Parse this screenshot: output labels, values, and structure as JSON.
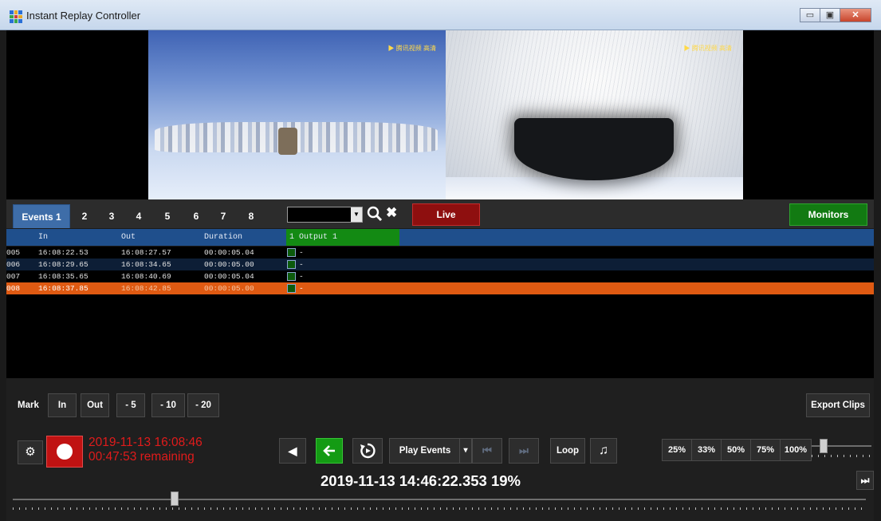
{
  "window": {
    "title": "Instant Replay Controller",
    "minimize": "▭",
    "restore": "▣",
    "close": "✕"
  },
  "video": {
    "watermark_left": "▶ 腾讯视频 高清",
    "watermark_right": "▶ 腾讯视频 高清"
  },
  "tabs": [
    {
      "label": "Events 1",
      "active": true
    },
    {
      "label": "2"
    },
    {
      "label": "3"
    },
    {
      "label": "4"
    },
    {
      "label": "5"
    },
    {
      "label": "6"
    },
    {
      "label": "7"
    },
    {
      "label": "8"
    }
  ],
  "toolbar": {
    "combo_value": "",
    "live_label": "Live",
    "monitors_label": "Monitors",
    "live_color": "#8e0f0f",
    "monitors_color": "#127a12"
  },
  "table": {
    "columns": {
      "in": "In",
      "out": "Out",
      "duration": "Duration",
      "output": "1 Output 1"
    },
    "rows": [
      {
        "id": "005",
        "in": "16:08:22.53",
        "out": "16:08:27.57",
        "duration": "00:00:05.04",
        "output": "-",
        "selected": false
      },
      {
        "id": "006",
        "in": "16:08:29.65",
        "out": "16:08:34.65",
        "duration": "00:00:05.00",
        "output": "-",
        "selected": false
      },
      {
        "id": "007",
        "in": "16:08:35.65",
        "out": "16:08:40.69",
        "duration": "00:00:05.04",
        "output": "-",
        "selected": false
      },
      {
        "id": "008",
        "in": "16:08:37.85",
        "out": "16:08:42.85",
        "duration": "00:00:05.00",
        "output": "-",
        "selected": true
      }
    ],
    "selected_color": "#df5a12"
  },
  "mark": {
    "label": "Mark",
    "in": "In",
    "out": "Out",
    "minus5": "- 5",
    "minus10": "- 10",
    "minus20": "- 20",
    "export": "Export Clips"
  },
  "recording": {
    "line1": "2019-11-13 16:08:46",
    "line2": "00:47:53 remaining",
    "text_color": "#e01b1b"
  },
  "transport": {
    "prev": "◀",
    "back": "🡐",
    "replay_icon": "replay-icon",
    "play_events": "Play Events",
    "dropdown": "▾",
    "skip_back": "⏮",
    "skip_forward": "⏭",
    "loop": "Loop",
    "music": "♫",
    "end": "⏭"
  },
  "speeds": [
    "25%",
    "33%",
    "50%",
    "75%",
    "100%"
  ],
  "speed_slider_level": 0.2,
  "status": {
    "timestamp": "2019-11-13 14:46:22.353  19%"
  },
  "timeline_level": 0.19
}
